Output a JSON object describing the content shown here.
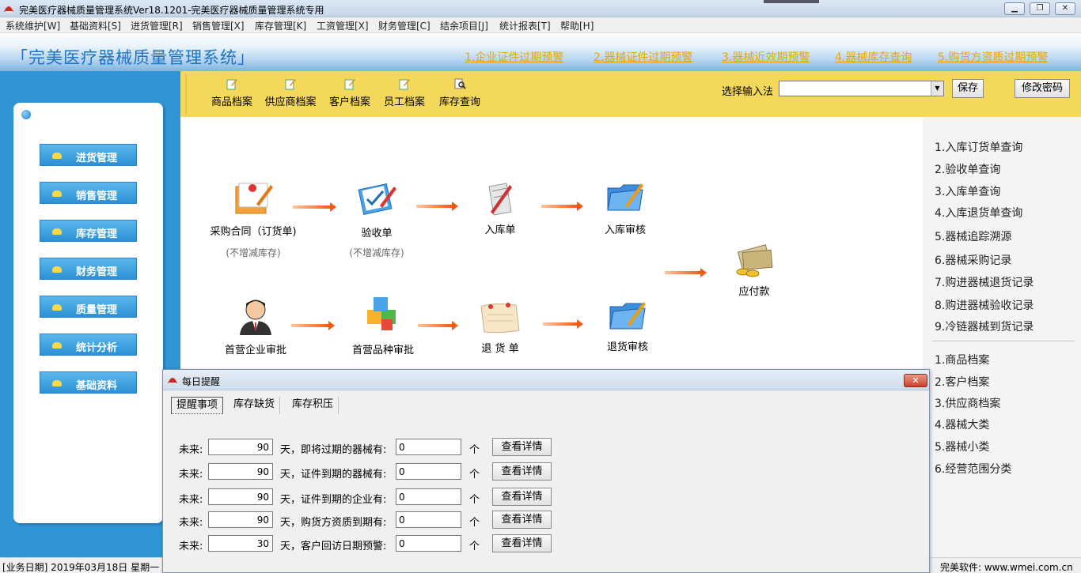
{
  "window": {
    "title": "完美医疗器械质量管理系统Ver18.1201-完美医疗器械质量管理系统专用",
    "minimize": "▁",
    "restore": "❐",
    "close": "✕"
  },
  "menu": [
    "系统维护[W]",
    "基础资料[S]",
    "进货管理[R]",
    "销售管理[X]",
    "库存管理[K]",
    "工资管理[X]",
    "财务管理[C]",
    "结余项目[J]",
    "统计报表[T]",
    "帮助[H]"
  ],
  "header": {
    "system_title": "「完美医疗器械质量管理系统」",
    "warnings": [
      "1.企业证件过期预警",
      "2.器械证件过期预警",
      "3.器械近效期预警",
      "4.器械库存查询",
      "5.购货方资质过期预警"
    ]
  },
  "sidebar": [
    "进货管理",
    "销售管理",
    "库存管理",
    "财务管理",
    "质量管理",
    "统计分析",
    "基础资料"
  ],
  "toolbar": {
    "items": [
      "商品档案",
      "供应商档案",
      "客户档案",
      "员工档案",
      "库存查询"
    ],
    "ime_label": "选择输入法",
    "ime_value": "",
    "save": "保存",
    "change_password": "修改密码"
  },
  "flow": {
    "purchase_contract": "采购合同（订货单)",
    "purchase_contract_note": "(不增减库存)",
    "acceptance": "验收单",
    "acceptance_note": "(不增减库存)",
    "inbound": "入库单",
    "inbound_audit": "入库审核",
    "payable": "应付款",
    "first_enterprise": "首营企业审批",
    "first_variety": "首营品种审批",
    "return_order": "退 货 单",
    "return_audit": "退货审核"
  },
  "right_panel": {
    "queries": [
      "1.入库订货单查询",
      "2.验收单查询",
      "3.入库单查询",
      "4.入库退货单查询",
      "5.器械追踪溯源",
      "6.器械采购记录",
      "7.购进器械退货记录",
      "8.购进器械验收记录",
      "9.冷链器械到货记录"
    ],
    "archives": [
      "1.商品档案",
      "2.客户档案",
      "3.供应商档案",
      "4.器械大类",
      "5.器械小类",
      "6.经营范围分类"
    ]
  },
  "status": {
    "business_date": "[业务日期] 2019年03月18日  星期一",
    "vendor": "完美软件: www.wmei.com.cn"
  },
  "dialog": {
    "title": "每日提醒",
    "close": "✕",
    "tabs": [
      "提醒事项",
      "库存缺货",
      "库存积压"
    ],
    "rows": [
      {
        "prefix": "未来:",
        "days": "90",
        "desc": "天，即将过期的器械有:",
        "count": "0",
        "unit": "个",
        "button": "查看详情"
      },
      {
        "prefix": "未来:",
        "days": "90",
        "desc": "天，证件到期的器械有:",
        "count": "0",
        "unit": "个",
        "button": "查看详情"
      },
      {
        "prefix": "未来:",
        "days": "90",
        "desc": "天，证件到期的企业有:",
        "count": "0",
        "unit": "个",
        "button": "查看详情"
      },
      {
        "prefix": "未来:",
        "days": "90",
        "desc": "天，购货方资质到期有:",
        "count": "0",
        "unit": "个",
        "button": "查看详情"
      },
      {
        "prefix": "未来:",
        "days": "30",
        "desc": "天，客户回访日期预警:",
        "count": "0",
        "unit": "个",
        "button": "查看详情"
      }
    ]
  },
  "colors": {
    "accent_blue": "#2f95d4",
    "toolbar_yellow": "#f4d85c",
    "warning_link": "#e8a800",
    "arrow": "#f15a10"
  }
}
